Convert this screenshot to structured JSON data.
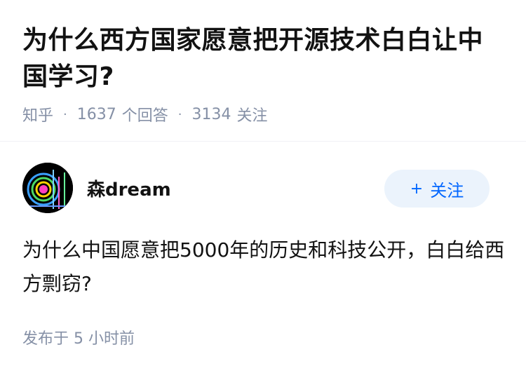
{
  "question": {
    "title": "为什么西方国家愿意把开源技术白白让中国学习?",
    "meta": {
      "source": "知乎",
      "answers_count": "1637",
      "answers_label": "个回答",
      "followers_count": "3134",
      "followers_label": "关注"
    }
  },
  "author": {
    "name": "森dream",
    "follow_label": "关注"
  },
  "answer": {
    "text": "为什么中国愿意把5000年的历史和科技公开，白白给西方剽窃?",
    "time_label": "发布于 5 小时前"
  },
  "colors": {
    "muted": "#8590a6",
    "accent": "#0066ff",
    "follow_bg": "#ebf3fc"
  }
}
